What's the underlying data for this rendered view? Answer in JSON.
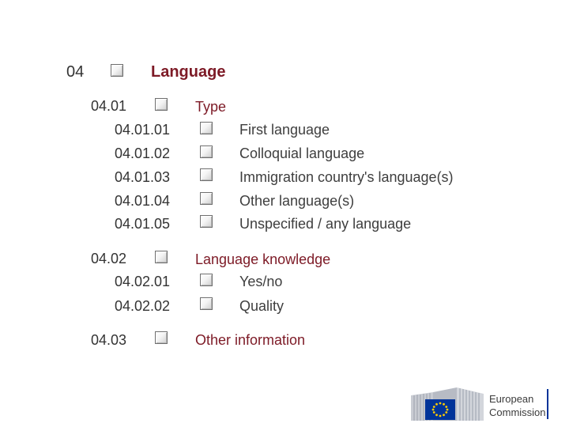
{
  "sections": {
    "s04": {
      "code": "04",
      "label": "Language"
    },
    "s0401": {
      "code": "04.01",
      "label": "Type"
    },
    "s040101": {
      "code": "04.01.01",
      "label": "First language"
    },
    "s040102": {
      "code": "04.01.02",
      "label": "Colloquial language"
    },
    "s040103": {
      "code": "04.01.03",
      "label": "Immigration country's language(s)"
    },
    "s040104": {
      "code": "04.01.04",
      "label": "Other language(s)"
    },
    "s040105": {
      "code": "04.01.05",
      "label": "Unspecified / any language"
    },
    "s0402": {
      "code": "04.02",
      "label": "Language knowledge"
    },
    "s040201": {
      "code": "04.02.01",
      "label": "Yes/no"
    },
    "s040202": {
      "code": "04.02.02",
      "label": "Quality"
    },
    "s0403": {
      "code": "04.03",
      "label": "Other information"
    }
  },
  "footer_logo": {
    "line1": "European",
    "line2": "Commission"
  },
  "colors": {
    "heading": "#7d1a26",
    "eu_blue": "#003399",
    "eu_star": "#ffcc00"
  }
}
